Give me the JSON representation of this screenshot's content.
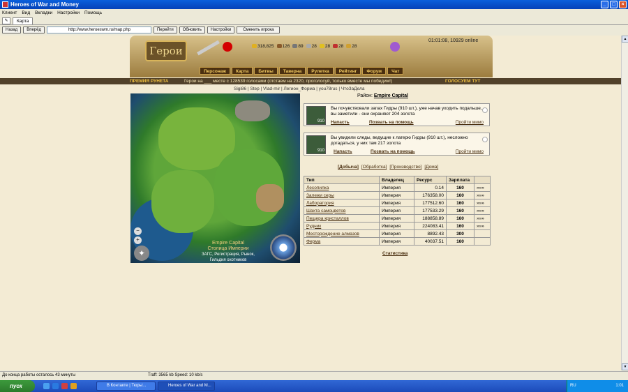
{
  "window": {
    "title": "Heroes of War and Money",
    "controls": [
      "_",
      "□",
      "×"
    ]
  },
  "menu": [
    "Клиент",
    "Вид",
    "Вкладки",
    "Настройки",
    "Помощь"
  ],
  "tab": {
    "label": "Карта"
  },
  "nav": {
    "back": "Назад",
    "forward": "Вперёд",
    "url": "http://www.heroeswm.ru/map.php",
    "go": "Перейти",
    "refresh": "Обновить",
    "settings": "Настройки",
    "switch_player": "Сменить игрока"
  },
  "game": {
    "logo": "Герои",
    "resources": [
      {
        "name": "gold",
        "value": "318,825"
      },
      {
        "name": "wood",
        "value": "126"
      },
      {
        "name": "ore",
        "value": "89"
      },
      {
        "name": "mercury",
        "value": "28"
      },
      {
        "name": "sulfur",
        "value": "28"
      },
      {
        "name": "crystals",
        "value": "28"
      },
      {
        "name": "gems",
        "value": "28"
      }
    ],
    "clock": "01:01:08, 10929 online",
    "nav": [
      "Персонаж",
      "Карта",
      "Битвы",
      "Таверна",
      "Рулетка",
      "Рейтинг",
      "Форум",
      "Чат"
    ],
    "promo_left": "ПРЕМИЯ РУНЕТА",
    "promo_mid": "Герои на ___ месте с 128539 голосами (отстаем на 2320, проголосуй, только вместе мы победим!)",
    "promo_right": "ГОЛОСУЕМ ТУТ",
    "users": "Sigi86 | Step | Vlad-mir | Легион_Форма | you78rus | ЧтоЗаДела",
    "map": {
      "caption": "Empire Capital",
      "caption2": "Столица Империи",
      "caption3": "ЗАГС, Регистрация, Рынок,",
      "caption4": "Гильдия охотников"
    },
    "district": {
      "label": "Район:",
      "value": "Empire Capital"
    },
    "events": [
      {
        "text": "Вы почувствовали запах Гидры (910 шт.), уже начав уходить подальше, вы заметили - они охраняют 204 золота",
        "count": "910",
        "attack": "Напасть",
        "help": "Позвать на помощь",
        "pass": "Пройти мимо"
      },
      {
        "text": "Вы увидели следы, ведущие к лагерю Гидры (910 шт.), несложно догадаться, у них там 217 золота",
        "count": "910",
        "attack": "Напасть",
        "help": "Позвать на помощь",
        "pass": "Пройти мимо"
      }
    ],
    "subtabs": [
      "[Добыча]",
      "[Обработка]",
      "[Производство]",
      "[Дома]"
    ],
    "table": {
      "headers": [
        "Тип",
        "Владелец",
        "Ресурс",
        "Зарплата",
        ""
      ],
      "rows": [
        [
          "Лесопилка",
          "Империя",
          "0.14",
          "160",
          "»»»"
        ],
        [
          "Залежи серы",
          "Империя",
          "176358.00",
          "160",
          "»»»"
        ],
        [
          "Лаборатория",
          "Империя",
          "177512.60",
          "160",
          "»»»"
        ],
        [
          "Шахта самоцветов",
          "Империя",
          "177533.29",
          "160",
          "»»»"
        ],
        [
          "Пещера кристаллов",
          "Империя",
          "188858.89",
          "160",
          "»»»"
        ],
        [
          "Рудник",
          "Империя",
          "224083.41",
          "160",
          "»»»"
        ],
        [
          "Месторождение алмазов",
          "Империя",
          "8892.43",
          "300",
          ""
        ],
        [
          "Ферма",
          "Империя",
          "40037.51",
          "160",
          ""
        ]
      ]
    },
    "stats": "Статистика"
  },
  "status": {
    "left": "До конца работы осталось 43 минуты",
    "right": "Traff: 3565 kb Speed: 10 kb/s"
  },
  "taskbar": {
    "start": "пуск",
    "tasks": [
      "В Контакте | Тюрьг...",
      "Heroes of War and M..."
    ],
    "lang": "RU",
    "time": "1:01"
  }
}
